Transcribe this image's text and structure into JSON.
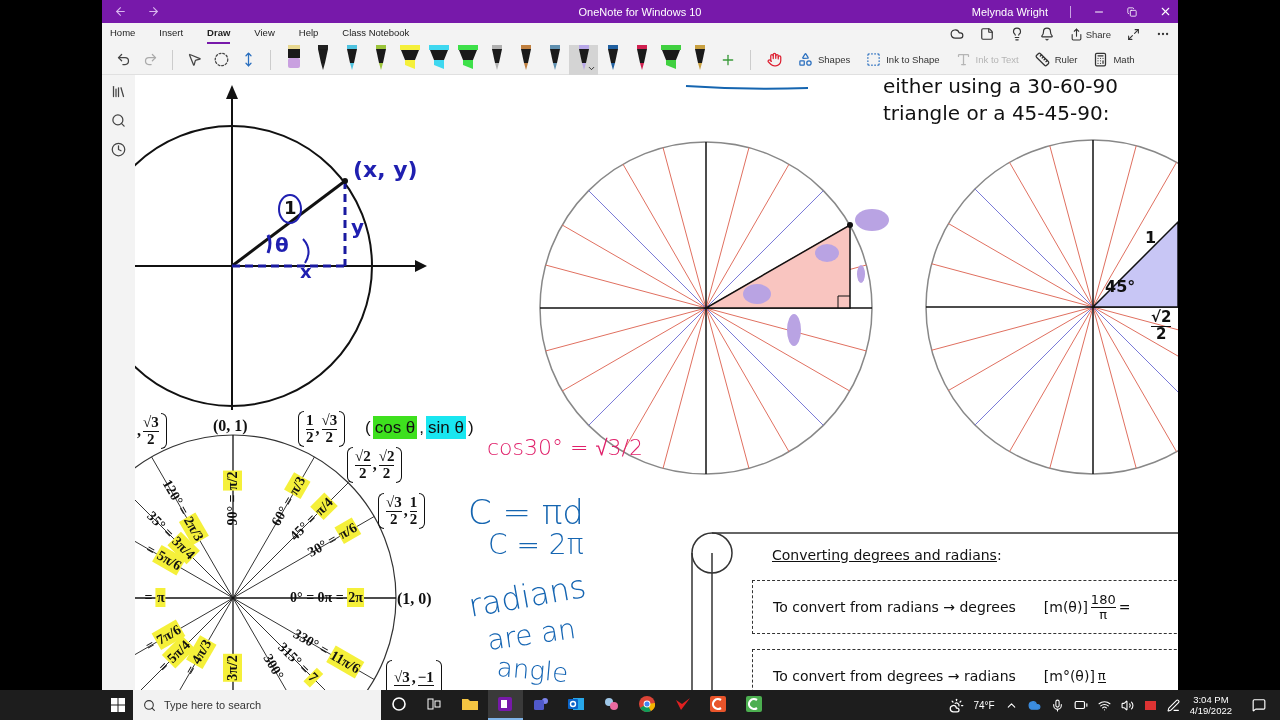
{
  "window": {
    "title": "OneNote for Windows 10",
    "user": "Melynda Wright"
  },
  "menu_tabs": [
    {
      "label": "Home",
      "selected": false
    },
    {
      "label": "Insert",
      "selected": false
    },
    {
      "label": "Draw",
      "selected": true
    },
    {
      "label": "View",
      "selected": false
    },
    {
      "label": "Help",
      "selected": false
    },
    {
      "label": "Class Notebook",
      "selected": false
    }
  ],
  "share_label": "Share",
  "pens": [
    {
      "kind": "eraser",
      "color": "#c9a0e0",
      "selected": false
    },
    {
      "kind": "pen",
      "color": "#202020",
      "selected": false
    },
    {
      "kind": "pen",
      "color": "#4fc3e0",
      "selected": false
    },
    {
      "kind": "pen",
      "color": "#9bc43a",
      "selected": false
    },
    {
      "kind": "highlighter",
      "color": "#f5f03a",
      "selected": false
    },
    {
      "kind": "highlighter",
      "color": "#3fd8f0",
      "selected": false
    },
    {
      "kind": "highlighter",
      "color": "#3ee04a",
      "selected": false
    },
    {
      "kind": "pen",
      "color": "#b0b0b0",
      "selected": false
    },
    {
      "kind": "pen",
      "color": "#c08040",
      "selected": false
    },
    {
      "kind": "pen",
      "color": "#6090b0",
      "selected": false
    },
    {
      "kind": "pen",
      "color": "#b8a8e8",
      "selected": true
    },
    {
      "kind": "pen",
      "color": "#2060a0",
      "selected": false
    },
    {
      "kind": "pen",
      "color": "#d02050",
      "selected": false
    },
    {
      "kind": "highlighter",
      "color": "#40d040",
      "selected": false
    },
    {
      "kind": "pen",
      "color": "#c8a040",
      "selected": false
    }
  ],
  "tools": [
    {
      "kind": "touch"
    },
    {
      "kind": "shapes",
      "label": "Shapes",
      "disabled": false
    },
    {
      "kind": "ink_to_shape",
      "label": "Ink to Shape",
      "disabled": false
    },
    {
      "kind": "ink_to_text",
      "label": "Ink to Text",
      "disabled": true
    },
    {
      "kind": "ruler",
      "label": "Ruler",
      "disabled": false
    },
    {
      "kind": "math",
      "label": "Math",
      "disabled": false
    }
  ],
  "page": {
    "note": "either using a 30-60-90 triangle or a 45-45-90:",
    "plane_labels": [
      "(x, y)",
      "1",
      "θ",
      "y",
      "x"
    ],
    "coordinates": [
      {
        "kind": "fractions",
        "separator": ",",
        "y": {
          "num": "√3",
          "den": "2"
        }
      },
      {
        "kind": "text",
        "text": "(0, 1)"
      },
      {
        "kind": "fractions",
        "separator": ",",
        "x": {
          "num": "1",
          "den": "2"
        },
        "y": {
          "num": "√3",
          "den": "2"
        }
      },
      {
        "kind": "highlighted",
        "open": "(",
        "separator": ",",
        "close": ")",
        "parts": [
          {
            "text": "cos θ",
            "color": "#3ee01e"
          },
          {
            "text": "sin θ",
            "color": "#19e6f0"
          }
        ]
      },
      {
        "kind": "fractions",
        "separator": ",",
        "x": {
          "num": "√2",
          "den": "2"
        },
        "y": {
          "num": "√2",
          "den": "2"
        }
      },
      {
        "kind": "fractions",
        "separator": ",",
        "x": {
          "num": "√3",
          "den": "2"
        },
        "y": {
          "num": "1",
          "den": "2"
        }
      },
      {
        "kind": "text",
        "text": "(1, 0)"
      },
      {
        "kind": "fractions",
        "separator": ",",
        "x": {
          "num": "√3"
        },
        "y": {
          "num": "−1"
        }
      }
    ],
    "angles": [
      {
        "degrees": "90° =",
        "radians": "π/2"
      },
      {
        "degrees": "60° =",
        "radians": "π/3"
      },
      {
        "degrees": "45° =",
        "radians": "π/4"
      },
      {
        "degrees": "30° =",
        "radians": "π/6"
      },
      {
        "degrees": "=",
        "radians": "π"
      },
      {
        "degrees": "0° = 0π =",
        "radians": "2π"
      },
      {
        "degrees": "120° =",
        "radians": "2π/3"
      },
      {
        "degrees": "35° =",
        "radians": "3π/4"
      },
      {
        "degrees": "=",
        "radians": "5π/6"
      },
      {
        "degrees": "=",
        "radians": "7π/6"
      },
      {
        "degrees": "=",
        "radians": "5π/4"
      },
      {
        "degrees": "=",
        "radians": "4π/3"
      },
      {
        "radians": "3π/2"
      },
      {
        "degrees": "300°"
      },
      {
        "degrees": "315° =",
        "radians": "7"
      },
      {
        "degrees": "330° =",
        "radians": "11π/6"
      }
    ],
    "reference_labels": [
      {
        "kind": "text",
        "text": "1"
      },
      {
        "kind": "text",
        "text": "45°"
      },
      {
        "kind": "fraction",
        "num": "√2",
        "den": "2"
      }
    ],
    "handwriting": [
      {
        "text": "cos30° = √3/2",
        "color": "#e0206a"
      },
      {
        "text": "C = πd",
        "color": "#1565b0"
      },
      {
        "text": "C = 2π",
        "color": "#1565b1"
      },
      {
        "text": "radians",
        "color": "#1565b2"
      },
      {
        "text": "are an",
        "color": "#1565b3"
      },
      {
        "text": "angle",
        "color": "#1565b4"
      }
    ],
    "conversion": {
      "title": "Converting degrees and radians",
      "title_suffix": ":",
      "rows": [
        {
          "text": "To convert from radians → degrees",
          "prefix": "[m(θ)]",
          "num": "180",
          "den": "π",
          "suffix": "="
        },
        {
          "text": "To convert from degrees → radians",
          "prefix": "[m°(θ)]",
          "num": "π"
        }
      ]
    }
  },
  "taskbar": {
    "search_placeholder": "Type here to search",
    "apps": [
      {
        "kind": "cortana",
        "active": false
      },
      {
        "kind": "task_view",
        "active": false
      },
      {
        "kind": "explorer",
        "active": false
      },
      {
        "kind": "onenote",
        "active": true
      },
      {
        "kind": "teams",
        "active": false
      },
      {
        "kind": "outlook",
        "active": false
      },
      {
        "kind": "snip",
        "active": false
      },
      {
        "kind": "chrome",
        "active": false
      },
      {
        "kind": "v_app",
        "active": false
      },
      {
        "kind": "c_orange",
        "active": false
      },
      {
        "kind": "c_green",
        "active": false
      }
    ],
    "weather": "74°F",
    "time": "3:04 PM",
    "date": "4/19/2022"
  }
}
